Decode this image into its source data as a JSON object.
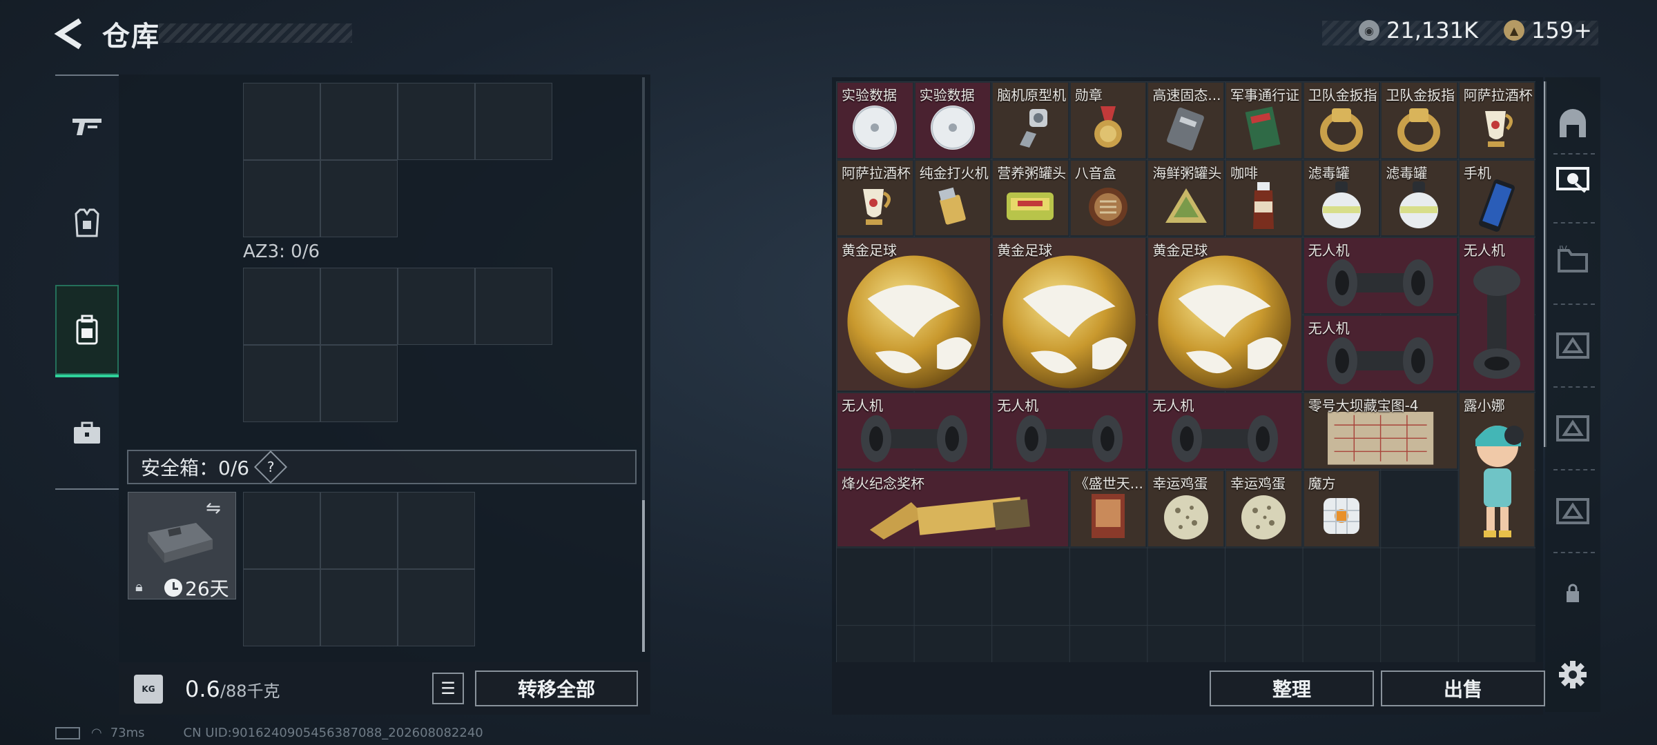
{
  "header": {
    "title": "仓库",
    "currency_a": "21,131K",
    "currency_b": "159+"
  },
  "left": {
    "az3_label": "AZ3: 0/6",
    "safebox_label": "安全箱：0/6",
    "safebox_help": "?",
    "case_duration": "26天",
    "weight_value": "0.6",
    "weight_max": "/88千克",
    "transfer_all": "转移全部"
  },
  "inventory": [
    {
      "name": "实验数据",
      "icon": "disc"
    },
    {
      "name": "实验数据",
      "icon": "disc"
    },
    {
      "name": "脑机原型机",
      "icon": "device"
    },
    {
      "name": "勋章",
      "icon": "medal"
    },
    {
      "name": "高速固态...",
      "icon": "ssd"
    },
    {
      "name": "军事通行证",
      "icon": "pass"
    },
    {
      "name": "卫队金扳指",
      "icon": "ring"
    },
    {
      "name": "卫队金扳指",
      "icon": "ring"
    },
    {
      "name": "阿萨拉酒杯",
      "icon": "cup"
    },
    {
      "name": "阿萨拉酒杯",
      "icon": "cup"
    },
    {
      "name": "纯金打火机",
      "icon": "lighter"
    },
    {
      "name": "营养粥罐头",
      "icon": "can"
    },
    {
      "name": "八音盒",
      "icon": "musicbox"
    },
    {
      "name": "海鲜粥罐头",
      "icon": "can2"
    },
    {
      "name": "咖啡",
      "icon": "coffee"
    },
    {
      "name": "滤毒罐",
      "icon": "filter"
    },
    {
      "name": "滤毒罐",
      "icon": "filter"
    },
    {
      "name": "手机",
      "icon": "phone"
    },
    {
      "name": "黄金足球",
      "icon": "ball"
    },
    {
      "name": "黄金足球",
      "icon": "ball"
    },
    {
      "name": "黄金足球",
      "icon": "ball"
    },
    {
      "name": "无人机",
      "icon": "drone"
    },
    {
      "name": "无人机",
      "icon": "drone-v"
    },
    {
      "name": "无人机",
      "icon": "drone"
    },
    {
      "name": "无人机",
      "icon": "drone"
    },
    {
      "name": "无人机",
      "icon": "drone"
    },
    {
      "name": "无人机",
      "icon": "drone"
    },
    {
      "name": "零号大坝藏宝图-4",
      "icon": "map"
    },
    {
      "name": "露小娜",
      "icon": "figure"
    },
    {
      "name": "烽火纪念奖杯",
      "icon": "trophy"
    },
    {
      "name": "《盛世天...",
      "icon": "book"
    },
    {
      "name": "幸运鸡蛋",
      "icon": "egg"
    },
    {
      "name": "幸运鸡蛋",
      "icon": "egg"
    },
    {
      "name": "魔方",
      "icon": "cube"
    }
  ],
  "actions": {
    "sort": "整理",
    "sell": "出售"
  },
  "status": {
    "ping": "73ms",
    "uid": "CN UID:9016240905456387088_202608082240"
  },
  "colors": {
    "accent": "#2fd29a",
    "red_item": "#4a2230",
    "brown_item": "#3d3129"
  }
}
